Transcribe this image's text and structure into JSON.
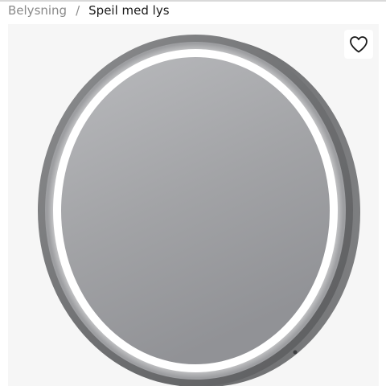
{
  "breadcrumb": {
    "parent": "Belysning",
    "separator": "/",
    "current": "Speil med lys"
  },
  "product": {
    "image_subject": "round-led-mirror"
  },
  "wishlist": {
    "icon": "heart-icon"
  },
  "colors": {
    "frame": "#6f7072",
    "mirror": "#a3a4a7",
    "light_ring": "#ffffff",
    "gallery_background": "#f6f6f6",
    "breadcrumb_muted": "#8a8a8a",
    "breadcrumb_active": "#1a1a1a"
  }
}
